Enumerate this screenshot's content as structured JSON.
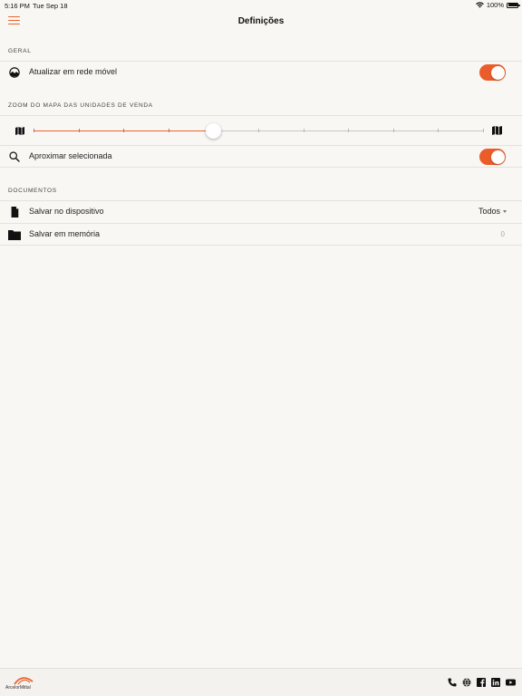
{
  "status_bar": {
    "time": "5:16 PM",
    "date": "Tue Sep 18",
    "battery": "100%"
  },
  "nav": {
    "title": "Definições",
    "menu_icon": "hamburger-menu-icon"
  },
  "sections": {
    "geral": {
      "header": "GERAL",
      "mobile_update": {
        "label": "Atualizar em rede móvel",
        "icon": "network-icon",
        "enabled": true
      }
    },
    "zoom": {
      "header": "ZOOM DO MAPA DAS UNIDADES DE VENDA",
      "slider": {
        "steps": 10,
        "value": 4,
        "min_icon": "map-small-icon",
        "max_icon": "map-large-icon"
      },
      "zoom_selected": {
        "label": "Aproximar selecionada",
        "icon": "search-icon",
        "enabled": true
      }
    },
    "documentos": {
      "header": "DOCUMENTOS",
      "save_device": {
        "label": "Salvar no dispositivo",
        "icon": "document-icon",
        "value": "Todos"
      },
      "save_memory": {
        "label": "Salvar em memória",
        "icon": "folder-icon",
        "value": "0"
      }
    }
  },
  "footer": {
    "logo_text": "ArcelorMittal",
    "icons": [
      "phone-icon",
      "globe-icon",
      "facebook-icon",
      "linkedin-icon",
      "youtube-icon"
    ]
  },
  "colors": {
    "accent": "#ea5d2a",
    "background": "#f8f7f4"
  }
}
